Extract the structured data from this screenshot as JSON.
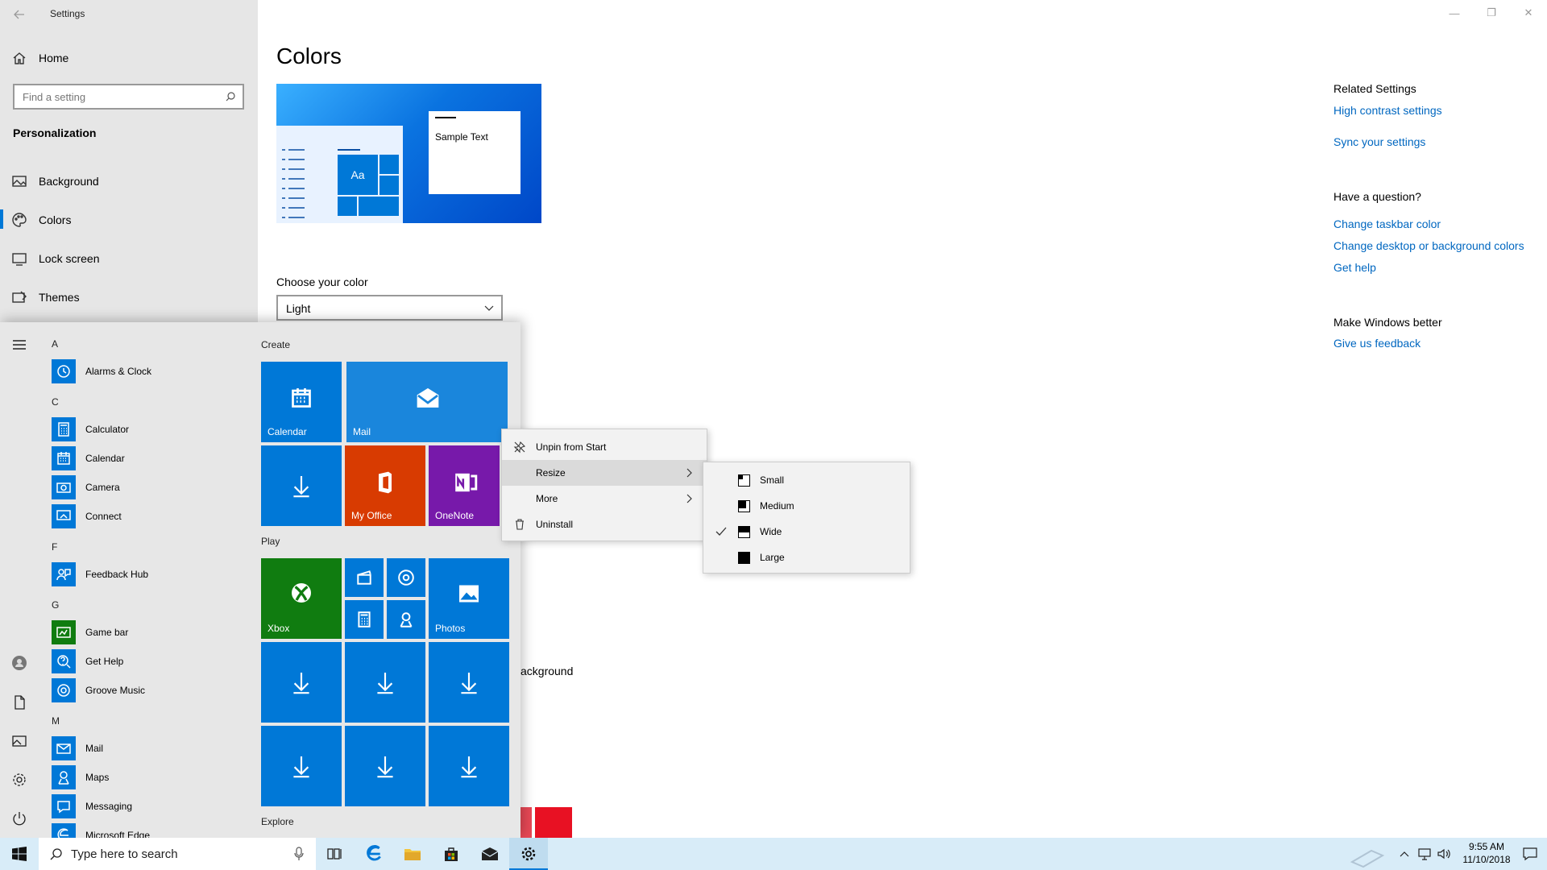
{
  "window": {
    "title": "Settings",
    "minimize": "—",
    "restore": "❐",
    "close": "✕"
  },
  "sidebar": {
    "home": "Home",
    "search_placeholder": "Find a setting",
    "section": "Personalization",
    "items": [
      {
        "label": "Background"
      },
      {
        "label": "Colors"
      },
      {
        "label": "Lock screen"
      },
      {
        "label": "Themes"
      }
    ]
  },
  "main": {
    "title": "Colors",
    "preview_sample": "Sample Text",
    "preview_tile": "Aa",
    "choose_label": "Choose your color",
    "choose_value": "Light",
    "partial_text": "ackground"
  },
  "related": {
    "heading": "Related Settings",
    "links": [
      "High contrast settings",
      "Sync your settings"
    ],
    "question_heading": "Have a question?",
    "question_links": [
      "Change taskbar color",
      "Change desktop or background colors",
      "Get help"
    ],
    "better_heading": "Make Windows better",
    "feedback": "Give us feedback"
  },
  "start_menu": {
    "apps": [
      {
        "type": "header",
        "label": "A"
      },
      {
        "type": "app",
        "label": "Alarms & Clock",
        "icon": "clock-icon"
      },
      {
        "type": "header",
        "label": "C"
      },
      {
        "type": "app",
        "label": "Calculator",
        "icon": "calculator-icon"
      },
      {
        "type": "app",
        "label": "Calendar",
        "icon": "calendar-icon"
      },
      {
        "type": "app",
        "label": "Camera",
        "icon": "camera-icon"
      },
      {
        "type": "app",
        "label": "Connect",
        "icon": "connect-icon"
      },
      {
        "type": "header",
        "label": "F"
      },
      {
        "type": "app",
        "label": "Feedback Hub",
        "icon": "feedback-icon"
      },
      {
        "type": "header",
        "label": "G"
      },
      {
        "type": "app",
        "label": "Game bar",
        "icon": "gamebar-icon"
      },
      {
        "type": "app",
        "label": "Get Help",
        "icon": "help-icon"
      },
      {
        "type": "app",
        "label": "Groove Music",
        "icon": "music-icon"
      },
      {
        "type": "header",
        "label": "M"
      },
      {
        "type": "app",
        "label": "Mail",
        "icon": "mail-icon"
      },
      {
        "type": "app",
        "label": "Maps",
        "icon": "maps-icon"
      },
      {
        "type": "app",
        "label": "Messaging",
        "icon": "messaging-icon"
      },
      {
        "type": "app",
        "label": "Microsoft Edge",
        "icon": "edge-icon"
      }
    ],
    "groups": {
      "create": "Create",
      "play": "Play",
      "explore": "Explore"
    },
    "tiles": {
      "calendar": "Calendar",
      "mail": "Mail",
      "my_office": "My Office",
      "onenote": "OneNote",
      "xbox": "Xbox",
      "photos": "Photos"
    }
  },
  "context_menu": {
    "items": [
      "Unpin from Start",
      "Resize",
      "More",
      "Uninstall"
    ]
  },
  "resize_menu": {
    "items": [
      "Small",
      "Medium",
      "Wide",
      "Large"
    ],
    "checked": "Wide"
  },
  "taskbar": {
    "search_placeholder": "Type here to search",
    "time": "9:55 AM",
    "date": "11/10/2018"
  },
  "colors": {
    "accent": "#0078d7",
    "link": "#0067c0",
    "office": "#d83b01",
    "onenote": "#7719aa",
    "xbox": "#107c10"
  }
}
